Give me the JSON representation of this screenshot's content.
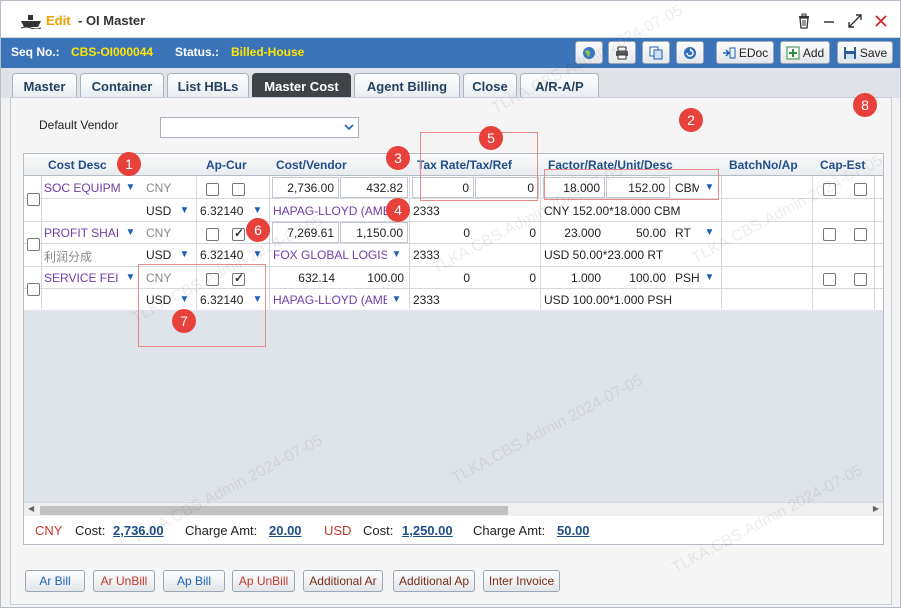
{
  "window": {
    "mode": "Edit",
    "title": "- OI Master",
    "accent": "#f0a000"
  },
  "header": {
    "seq_label": "Seq No.:",
    "seq_value": "CBS-OI000044",
    "status_label": "Status.:",
    "status_value": "Billed-House"
  },
  "toolbar": {
    "edoc": "EDoc",
    "add": "Add",
    "save": "Save"
  },
  "tabs": [
    {
      "label": "Master"
    },
    {
      "label": "Container"
    },
    {
      "label": "List HBLs"
    },
    {
      "label": "Master Cost"
    },
    {
      "label": "Agent Billing"
    },
    {
      "label": "Close"
    },
    {
      "label": "A/R-A/P"
    }
  ],
  "active_tab": "Master Cost",
  "default_vendor": {
    "label": "Default Vendor",
    "value": ""
  },
  "grid": {
    "headers": {
      "cost_desc": "Cost Desc",
      "ap_cur": "Ap-Cur",
      "cost_vendor": "Cost/Vendor",
      "tax": "Tax Rate/Tax/Ref",
      "factor": "Factor/Rate/Unit/Desc",
      "batch": "BatchNo/Ap",
      "cap": "Cap-Est"
    },
    "rows": [
      {
        "cost_desc": "SOC EQUIPM",
        "cost_desc_sub": "",
        "cur1": "CNY",
        "cur2": "USD",
        "ex_rate": "6.32140",
        "cost": "2,736.00",
        "cost2": "432.82",
        "vendor": "HAPAG-LLOYD (AME",
        "tax_rate": "0",
        "tax": "0",
        "ref": "2333",
        "factor": "18.000",
        "rate": "152.00",
        "unit": "CBM",
        "desc": "CNY 152.00*18.000 CBM",
        "chk_a": false,
        "chk_b": false
      },
      {
        "cost_desc": "PROFIT SHAI",
        "cost_desc_sub": "利润分成",
        "cur1": "CNY",
        "cur2": "USD",
        "ex_rate": "6.32140",
        "cost": "7,269.61",
        "cost2": "1,150.00",
        "vendor": "FOX GLOBAL LOGIS",
        "tax_rate": "0",
        "tax": "0",
        "ref": "2333",
        "factor": "23.000",
        "rate": "50.00",
        "unit": "RT",
        "desc": "USD 50.00*23.000 RT",
        "chk_a": false,
        "chk_b": true
      },
      {
        "cost_desc": "SERVICE FEI",
        "cost_desc_sub": "",
        "cur1": "CNY",
        "cur2": "USD",
        "ex_rate": "6.32140",
        "cost": "632.14",
        "cost2": "100.00",
        "vendor": "HAPAG-LLOYD (AME",
        "tax_rate": "0",
        "tax": "0",
        "ref": "2333",
        "factor": "1.000",
        "rate": "100.00",
        "unit": "PSH",
        "desc": "USD 100.00*1.000 PSH",
        "chk_a": false,
        "chk_b": true
      }
    ]
  },
  "summary": {
    "cny_label": "CNY",
    "cny_cost_label": "Cost:",
    "cny_cost": "2,736.00",
    "cny_charge_label": "Charge Amt:",
    "cny_charge": "20.00",
    "usd_label": "USD",
    "usd_cost_label": "Cost:",
    "usd_cost": "1,250.00",
    "usd_charge_label": "Charge Amt:",
    "usd_charge": "50.00"
  },
  "bottom_buttons": {
    "ar_bill": "Ar Bill",
    "ar_unbill": "Ar UnBill",
    "ap_bill": "Ap Bill",
    "ap_unbill": "Ap UnBill",
    "additional_ar": "Additional Ar",
    "additional_ap": "Additional Ap",
    "inter_invoice": "Inter Invoice"
  },
  "markers": [
    "1",
    "2",
    "3",
    "4",
    "5",
    "6",
    "7",
    "8"
  ],
  "watermark": "TLKA.CBS.Admin 2024-07-05"
}
